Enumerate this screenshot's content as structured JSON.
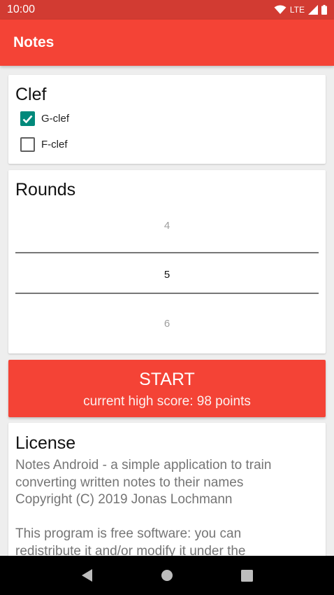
{
  "status": {
    "time": "10:00",
    "network": "LTE"
  },
  "app": {
    "title": "Notes",
    "accent": "#f44336"
  },
  "clef": {
    "title": "Clef",
    "options": [
      {
        "label": "G-clef",
        "checked": true
      },
      {
        "label": "F-clef",
        "checked": false
      }
    ]
  },
  "rounds": {
    "title": "Rounds",
    "prev": "4",
    "current": "5",
    "next": "6"
  },
  "start": {
    "label": "START",
    "subtitle": "current high score: 98 points"
  },
  "license": {
    "title": "License",
    "para1": [
      "Notes Android - a simple application to train",
      "converting written notes to their names",
      "Copyright (C) 2019 Jonas Lochmann"
    ],
    "para2": [
      "This program is free software: you can",
      "redistribute it and/or modify it under the"
    ]
  },
  "nav": {
    "back": "back-icon",
    "home": "home-icon",
    "recents": "recents-icon"
  }
}
